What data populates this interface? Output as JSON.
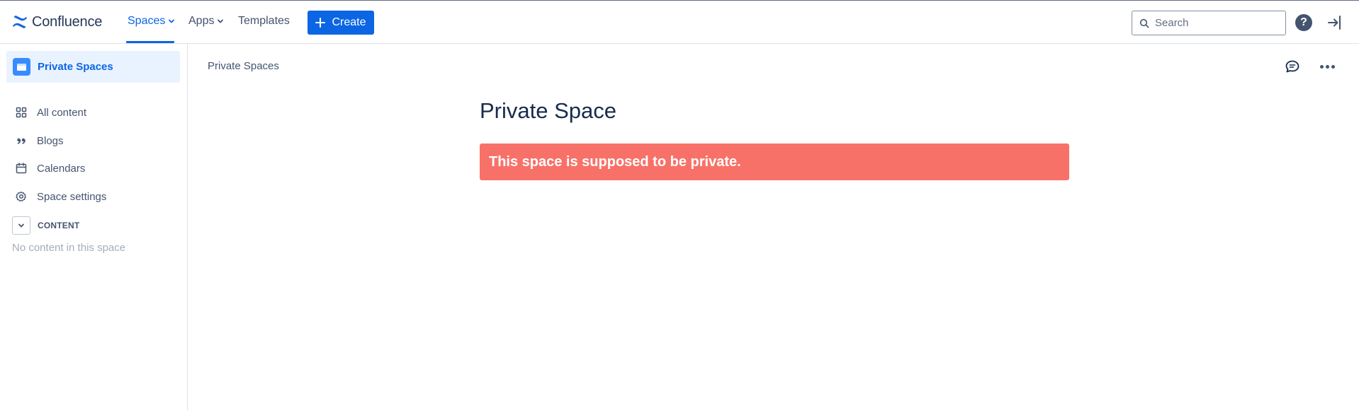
{
  "app": {
    "name": "Confluence"
  },
  "nav": {
    "spaces_label": "Spaces",
    "apps_label": "Apps",
    "templates_label": "Templates",
    "create_label": "Create"
  },
  "search": {
    "placeholder": "Search",
    "value": ""
  },
  "header": {
    "help_glyph": "?"
  },
  "sidebar": {
    "space_name": "Private Spaces",
    "items": [
      {
        "label": "All content",
        "icon": "grid-icon"
      },
      {
        "label": "Blogs",
        "icon": "quote-icon"
      },
      {
        "label": "Calendars",
        "icon": "calendar-icon"
      },
      {
        "label": "Space settings",
        "icon": "gear-icon"
      }
    ],
    "content_section_label": "CONTENT",
    "empty_text": "No content in this space"
  },
  "main": {
    "breadcrumb": "Private Spaces",
    "title": "Private Space",
    "alert_text": "This space is supposed to be private."
  },
  "colors": {
    "accent": "#0c66e4",
    "alert_background": "#f87168",
    "selected_background": "#e9f2ff"
  }
}
